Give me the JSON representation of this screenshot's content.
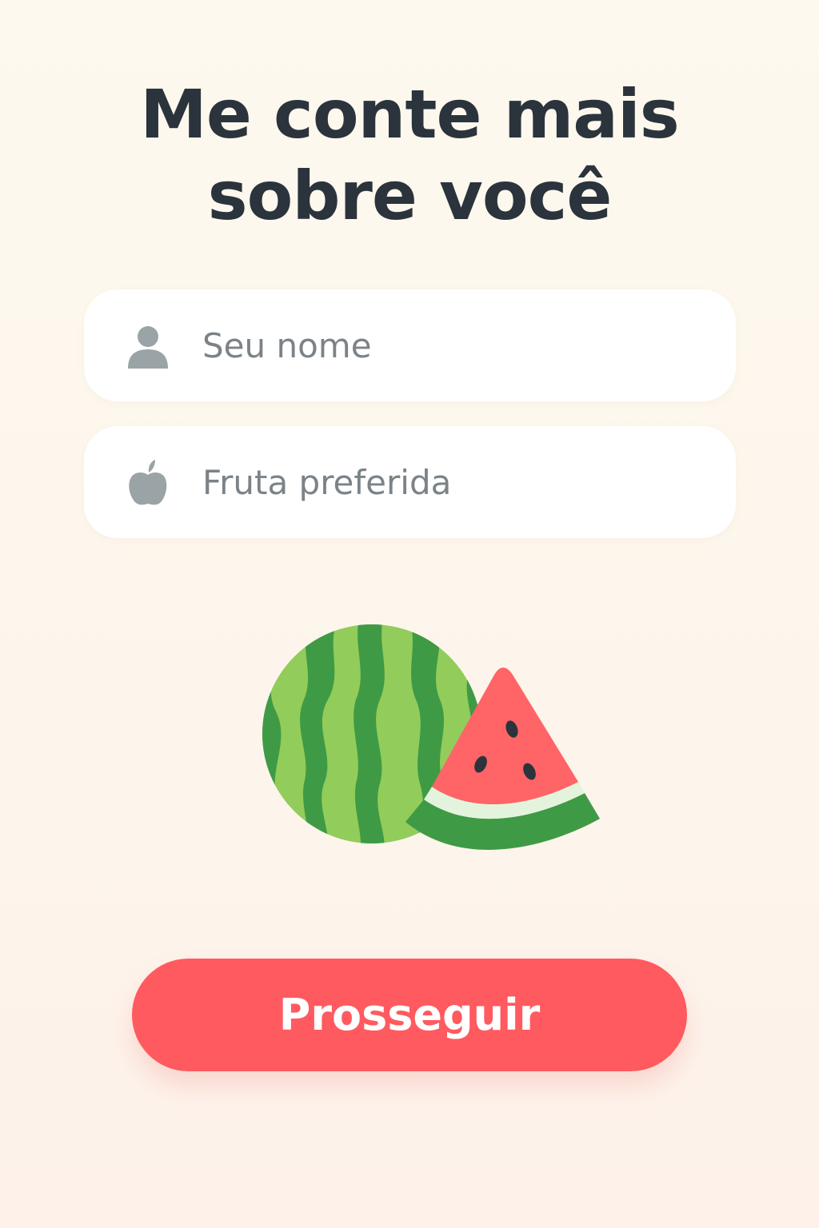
{
  "header": {
    "title_line1": "Me conte mais",
    "title_line2": "sobre você"
  },
  "form": {
    "name_field": {
      "placeholder": "Seu nome",
      "value": "",
      "icon": "person-icon"
    },
    "fruit_field": {
      "placeholder": "Fruta preferida",
      "value": "",
      "icon": "apple-icon"
    }
  },
  "illustration": {
    "name": "watermelon-illustration"
  },
  "actions": {
    "continue_label": "Prosseguir"
  },
  "colors": {
    "title": "#2b343c",
    "placeholder": "#7b8388",
    "icon": "#9aa3a6",
    "accent": "#ff5a5f",
    "watermelon_dark": "#3f9a45",
    "watermelon_light": "#92cc5a",
    "watermelon_flesh": "#ff6467"
  }
}
